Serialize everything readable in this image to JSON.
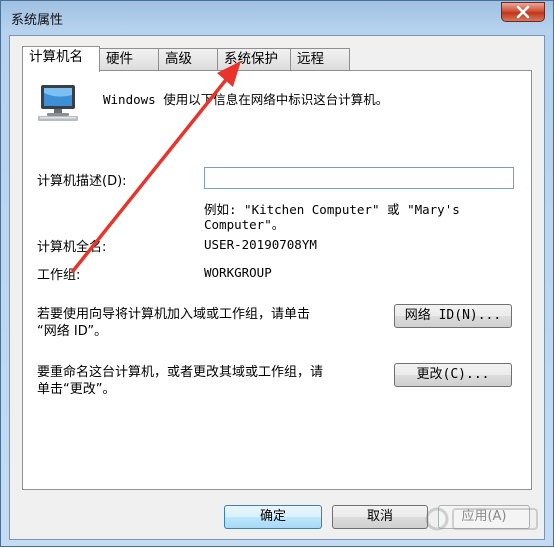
{
  "window": {
    "title": "系统属性"
  },
  "tabs": [
    {
      "label": "计算机名",
      "active": true
    },
    {
      "label": "硬件",
      "active": false
    },
    {
      "label": "高级",
      "active": false
    },
    {
      "label": "系统保护",
      "active": false
    },
    {
      "label": "远程",
      "active": false
    }
  ],
  "panel": {
    "intro": "Windows 使用以下信息在网络中标识这台计算机。",
    "description_label": "计算机描述(D):",
    "description_value": "",
    "example_line1": "例如: \"Kitchen Computer\" 或 \"Mary's",
    "example_line2": "Computer\"。",
    "full_name_label": "计算机全名:",
    "full_name_value": "USER-20190708YM",
    "workgroup_label": "工作组:",
    "workgroup_value": "WORKGROUP",
    "network_id_text_line1": "若要使用向导将计算机加入域或工作组，请单击",
    "network_id_text_line2": "“网络 ID”。",
    "network_id_button": "网络 ID(N)...",
    "rename_text_line1": "要重命名这台计算机，或者更改其域或工作组，请",
    "rename_text_line2": "单击“更改”。",
    "change_button": "更改(C)..."
  },
  "footer": {
    "ok_button": "确定",
    "cancel_button": "取消",
    "apply_button": "应用(A)"
  },
  "icons": {
    "close": "close-icon",
    "computer": "computer-icon"
  },
  "colors": {
    "annotation_arrow": "#e8342a",
    "default_button_border": "#3c7fb1"
  }
}
